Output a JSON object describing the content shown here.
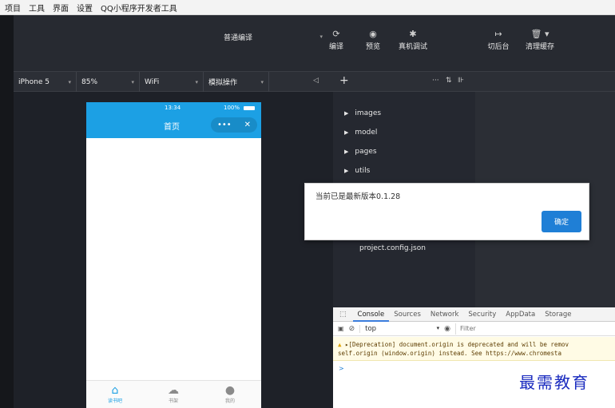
{
  "menubar": {
    "items": [
      "项目",
      "工具",
      "界面",
      "设置",
      "QQ小程序开发者工具"
    ]
  },
  "toolbar": {
    "compile_mode": "普通编译",
    "compile_label": "编译",
    "preview_label": "预览",
    "debug_label": "真机调试",
    "background_label": "切后台",
    "clear_cache_label": "清理缓存"
  },
  "subbar": {
    "device": "iPhone 5",
    "zoom": "85%",
    "network": "WiFi",
    "simulate_op": "模拟操作"
  },
  "phone": {
    "time": "13:34",
    "battery": "100%",
    "title": "首页",
    "more_label": "•••",
    "close_label": "✕",
    "tabs": [
      "读书吧",
      "书架",
      "我的"
    ]
  },
  "files": {
    "folders": [
      "images",
      "model",
      "pages",
      "utils"
    ],
    "config_file": "project.config.json"
  },
  "dialog": {
    "message": "当前已是最新版本0.1.28",
    "confirm_label": "确定"
  },
  "devtools": {
    "tabs": [
      "Console",
      "Sources",
      "Network",
      "Security",
      "AppData",
      "Storage"
    ],
    "context": "top",
    "filter_placeholder": "Filter",
    "warning_line1": "▸[Deprecation] document.origin is deprecated and will be remov",
    "warning_line2": "self.origin (window.origin) instead. See https://www.chromesta",
    "prompt": ">"
  },
  "watermark": "最需教育",
  "colors": {
    "accent": "#1ca0e4",
    "primary_button": "#1f7fd6"
  }
}
